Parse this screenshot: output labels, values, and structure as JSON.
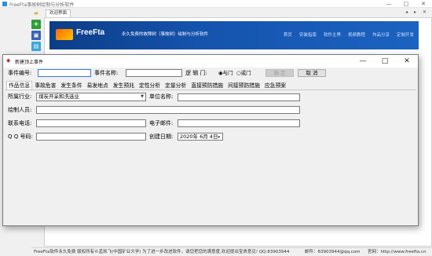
{
  "app": {
    "title": "FreeFta事故树绘制与分析软件",
    "window_buttons": [
      "—",
      "□",
      "✕"
    ]
  },
  "toolbar": {
    "icons": [
      "folder-icon",
      "add-icon",
      "save-icon",
      "export-icon",
      "help-icon"
    ]
  },
  "tab_bar": {
    "active_tab": "欢迎界面",
    "arrows": "◂ ▸ ✕"
  },
  "banner": {
    "brand": "FreeFta",
    "slogan": "永久免费的故障树（事故树）绘制与分析软件",
    "nav": [
      "首页",
      "安装指南",
      "软件主界",
      "视频教程",
      "作品分享",
      "定制开发"
    ]
  },
  "status_bar": {
    "left": "FreeFta软件永久免费 版权所有©孟凯飞(中国矿业大学)  为了进一步改进软件，请您把您的满意度,欢迎提出宝贵意见! QQ:83903944",
    "email": "邮件：83903944@qq.com",
    "website": "官网：http://www.freefta.cn"
  },
  "dialog": {
    "title": "新建顶上事件",
    "event_id_label": "事件编号:",
    "event_id_value": "",
    "event_name_label": "事件名称:",
    "event_name_value": "",
    "logic_gate_label": "逻 辑 门:",
    "or_gate_label": "与门",
    "and_gate_label": "或门",
    "selected_gate": "与门",
    "confirm_button": "确 定",
    "cancel_button": "取 消",
    "tabs": [
      "作品信息",
      "事故危害",
      "发生条件",
      "易发地点",
      "发生预兆",
      "定性分析",
      "定量分析",
      "直接预防措施",
      "间接预防措施",
      "应急预案"
    ],
    "active_tab": "作品信息",
    "form": {
      "industry_label": "所属行业:",
      "industry_value": "煤炭开采和洗选业",
      "org_label": "单位名称:",
      "org_value": "",
      "author_label": "绘制人员:",
      "author_value": "",
      "phone_label": "联系电话:",
      "phone_value": "",
      "email_label": "电子邮件:",
      "email_value": "",
      "qq_label": "Q Q 号码:",
      "qq_value": "",
      "date_label": "创建日期:",
      "date_value": "2020年  6月  4日"
    }
  }
}
